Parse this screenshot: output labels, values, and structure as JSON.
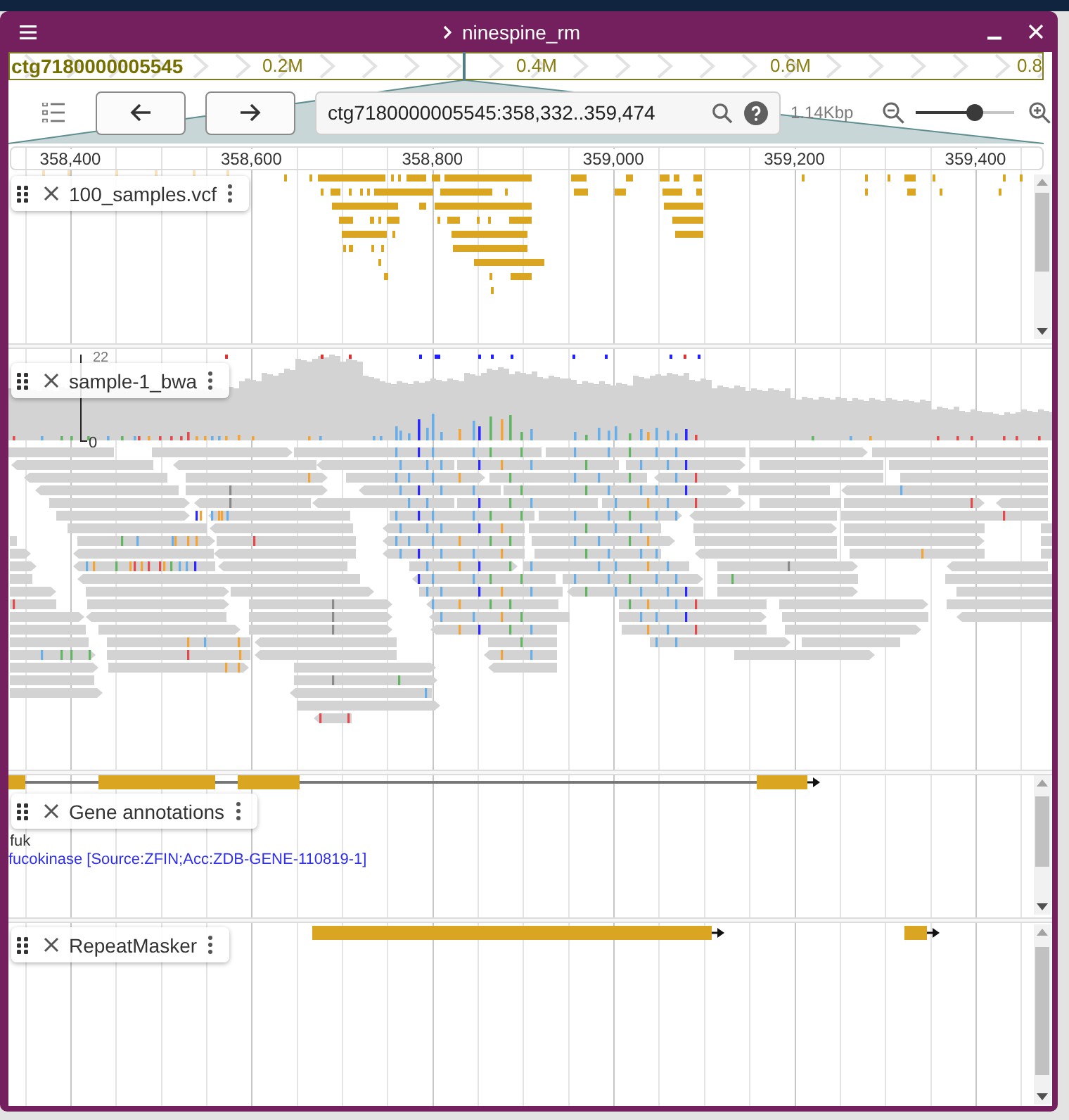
{
  "window": {
    "title": "ninespine_rm"
  },
  "overview": {
    "contig": "ctg7180000005545",
    "ticks": [
      "0.2M",
      "0.4M",
      "0.6M",
      "0.8"
    ]
  },
  "toolbar": {
    "location": "ctg7180000005545:358,332..359,474",
    "span": "1.14Kbp",
    "zoom": {
      "level": 0.6
    }
  },
  "ruler": {
    "ticks": [
      "358,400",
      "358,600",
      "358,800",
      "359,000",
      "359,200",
      "359,400"
    ]
  },
  "tracks": [
    {
      "kind": "variants",
      "name": "100_samples.vcf"
    },
    {
      "kind": "alignments",
      "name": "sample-1_bwa",
      "scale_max": "22",
      "scale_min": "0"
    },
    {
      "kind": "genes",
      "name": "Gene annotations",
      "gene_name": "fuk",
      "description": "fucokinase [Source:ZFIN;Acc:ZDB-GENE-110819-1]"
    },
    {
      "kind": "repeats",
      "name": "RepeatMasker"
    }
  ]
}
